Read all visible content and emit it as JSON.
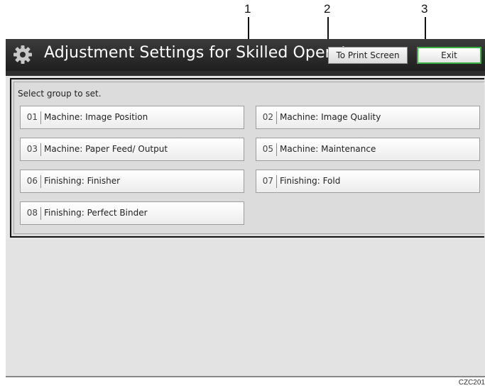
{
  "callouts": [
    "1",
    "2",
    "3"
  ],
  "titlebar": {
    "icon": "gear-icon",
    "title": "Adjustment Settings for Skilled Operators",
    "print_button": "To Print Screen",
    "exit_button": "Exit"
  },
  "panel": {
    "instruction": "Select group to set.",
    "groups": [
      {
        "num": "01",
        "label": "Machine: Image Position"
      },
      {
        "num": "02",
        "label": "Machine: Image Quality"
      },
      {
        "num": "03",
        "label": "Machine: Paper Feed/ Output"
      },
      {
        "num": "05",
        "label": "Machine: Maintenance"
      },
      {
        "num": "06",
        "label": "Finishing: Finisher"
      },
      {
        "num": "07",
        "label": "Finishing: Fold"
      },
      {
        "num": "08",
        "label": "Finishing: Perfect Binder"
      }
    ]
  },
  "figure_code": "CZC201",
  "colors": {
    "exit_border": "#3bb043",
    "titlebar": "#2a2a2a"
  }
}
